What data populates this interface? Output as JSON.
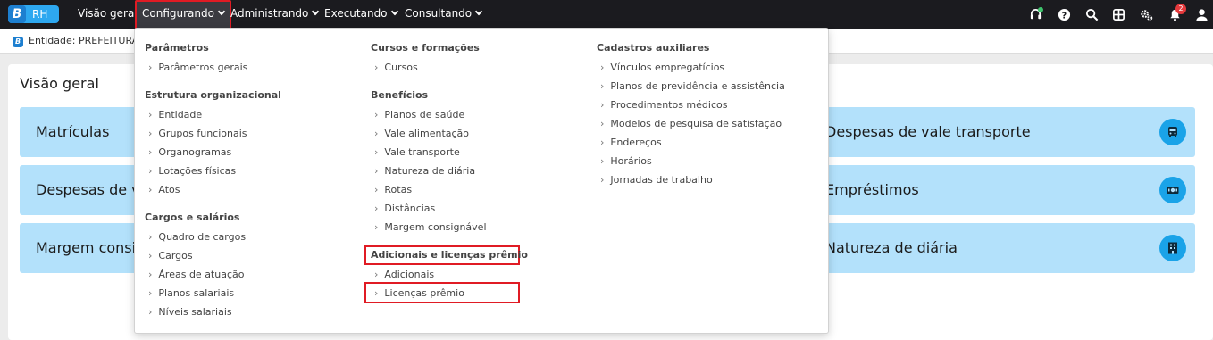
{
  "topbar": {
    "logo_text": "RH",
    "logo_letter": "B",
    "nav": [
      {
        "label": "Visão geral"
      },
      {
        "label": "Configurando"
      },
      {
        "label": "Administrando"
      },
      {
        "label": "Executando"
      },
      {
        "label": "Consultando"
      }
    ],
    "icons": [
      "headset-icon",
      "help-icon",
      "search-icon",
      "apps-grid-icon",
      "settings-gears-icon",
      "bell-icon",
      "user-icon"
    ],
    "notification_count": "2"
  },
  "context": {
    "entity_label": "Entidade: PREFEITURA D"
  },
  "main": {
    "title": "Visão geral",
    "cards_left": [
      {
        "label": "Matrículas"
      },
      {
        "label": "Despesas de val"
      },
      {
        "label": "Margem consig"
      }
    ],
    "cards_right": [
      {
        "label": "Despesas de vale transporte",
        "icon": "bus-icon"
      },
      {
        "label": "Empréstimos",
        "icon": "money-icon"
      },
      {
        "label": "Natureza de diária",
        "icon": "building-icon"
      }
    ]
  },
  "dropdown": {
    "col1": {
      "parametros": {
        "title": "Parâmetros",
        "items": [
          "Parâmetros gerais"
        ]
      },
      "estrutura": {
        "title": "Estrutura organizacional",
        "items": [
          "Entidade",
          "Grupos funcionais",
          "Organogramas",
          "Lotações físicas",
          "Atos"
        ]
      },
      "cargos": {
        "title": "Cargos e salários",
        "items": [
          "Quadro de cargos",
          "Cargos",
          "Áreas de atuação",
          "Planos salariais",
          "Níveis salariais"
        ]
      }
    },
    "col2": {
      "cursos": {
        "title": "Cursos e formações",
        "items": [
          "Cursos"
        ]
      },
      "beneficios": {
        "title": "Benefícios",
        "items": [
          "Planos de saúde",
          "Vale alimentação",
          "Vale transporte",
          "Natureza de diária",
          "Rotas",
          "Distâncias",
          "Margem consignável"
        ]
      },
      "adicionais": {
        "title": "Adicionais e licenças prêmio",
        "items": [
          "Adicionais",
          "Licenças prêmio"
        ]
      }
    },
    "col3": {
      "cadastros": {
        "title": "Cadastros auxiliares",
        "items": [
          "Vínculos empregatícios",
          "Planos de previdência e assistência",
          "Procedimentos médicos",
          "Modelos de pesquisa de satisfação",
          "Endereços",
          "Horários",
          "Jornadas de trabalho"
        ]
      }
    }
  },
  "colors": {
    "topbar": "#1b1b1f",
    "highlight": "#e01b24",
    "card": "#b3e1fb",
    "card_icon": "#1aa3e8"
  }
}
